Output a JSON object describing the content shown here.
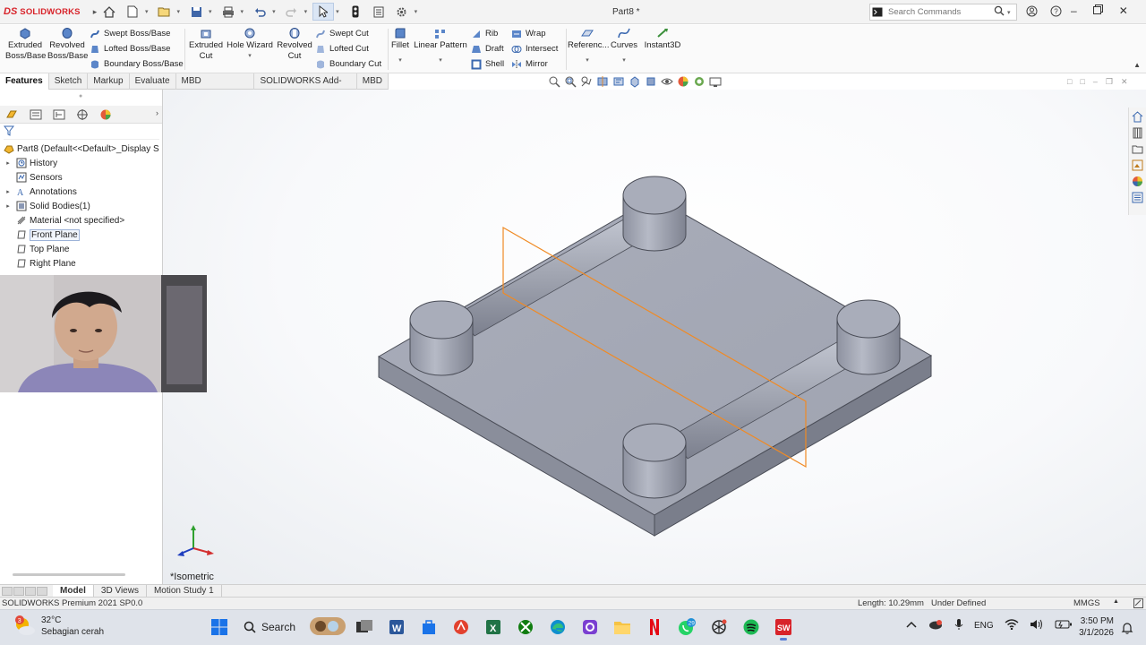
{
  "app": {
    "brand": "SOLIDWORKS",
    "doc_title": "Part8 *",
    "search_placeholder": "Search Commands"
  },
  "commands": {
    "extruded_boss": "Extruded Boss/Base",
    "revolved_boss": "Revolved Boss/Base",
    "swept_boss": "Swept Boss/Base",
    "lofted_boss": "Lofted Boss/Base",
    "boundary_boss": "Boundary Boss/Base",
    "extruded_cut": "Extruded Cut",
    "hole_wizard": "Hole Wizard",
    "revolved_cut": "Revolved Cut",
    "swept_cut": "Swept Cut",
    "lofted_cut": "Lofted Cut",
    "boundary_cut": "Boundary Cut",
    "fillet": "Fillet",
    "linear_pattern": "Linear Pattern",
    "rib": "Rib",
    "draft": "Draft",
    "shell": "Shell",
    "wrap": "Wrap",
    "intersect": "Intersect",
    "mirror": "Mirror",
    "reference": "Referenc...",
    "curves": "Curves",
    "instant3d": "Instant3D"
  },
  "tabs": [
    "Features",
    "Sketch",
    "Markup",
    "Evaluate",
    "MBD Dimensions",
    "SOLIDWORKS Add-Ins",
    "MBD"
  ],
  "tree": {
    "root": "Part8  (Default<<Default>_Display S",
    "items": [
      {
        "label": "History",
        "expandable": true,
        "icon": "history-icon"
      },
      {
        "label": "Sensors",
        "expandable": false,
        "icon": "sensors-icon"
      },
      {
        "label": "Annotations",
        "expandable": true,
        "icon": "annotations-icon"
      },
      {
        "label": "Solid Bodies(1)",
        "expandable": true,
        "icon": "solid-bodies-icon"
      },
      {
        "label": "Material <not specified>",
        "expandable": false,
        "icon": "material-icon"
      },
      {
        "label": "Front Plane",
        "expandable": false,
        "icon": "plane-icon",
        "highlighted": true
      },
      {
        "label": "Top Plane",
        "expandable": false,
        "icon": "plane-icon"
      },
      {
        "label": "Right Plane",
        "expandable": false,
        "icon": "plane-icon"
      }
    ]
  },
  "viewport": {
    "view_name": "*Isometric"
  },
  "bottom_tabs": [
    "Model",
    "3D Views",
    "Motion Study 1"
  ],
  "status": {
    "product": "SOLIDWORKS Premium 2021 SP0.0",
    "length": "Length: 10.29mm",
    "definition": "Under Defined",
    "units": "MMGS"
  },
  "taskbar": {
    "weather_badge": "3",
    "temperature": "32°C",
    "weather_desc": "Sebagian cerah",
    "search": "Search",
    "whatsapp_badge": "29",
    "language": "ENG",
    "time": "3:50 PM",
    "date": "3/1/2026"
  },
  "colors": {
    "brand": "#d8232a",
    "model_face": "#a7abb8",
    "plane_outline": "#f08a24"
  }
}
